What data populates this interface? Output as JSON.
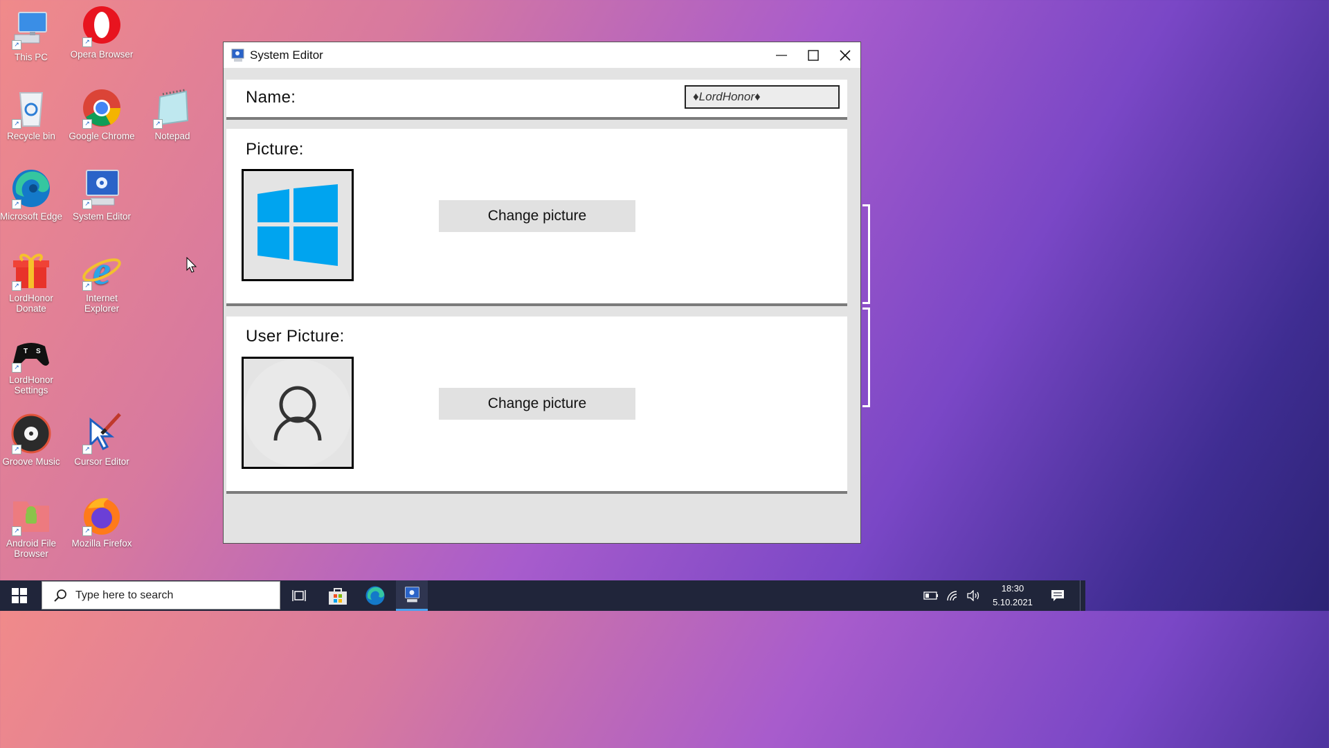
{
  "desktop": {
    "icons": [
      {
        "label": "This PC",
        "icon": "computer-icon"
      },
      {
        "label": "Opera Browser",
        "icon": "opera-icon"
      },
      {
        "label": "Recycle bin",
        "icon": "recycle-bin-icon"
      },
      {
        "label": "Google Chrome",
        "icon": "chrome-icon"
      },
      {
        "label": "Notepad",
        "icon": "notepad-icon"
      },
      {
        "label": "Microsoft Edge",
        "icon": "edge-icon"
      },
      {
        "label": "System Editor",
        "icon": "system-editor-icon"
      },
      {
        "label": "LordHonor Donate",
        "icon": "gift-icon"
      },
      {
        "label": "Internet Explorer",
        "icon": "ie-icon"
      },
      {
        "label": "LordHonor Settings",
        "icon": "gamepad-icon"
      },
      {
        "label": "Groove Music",
        "icon": "groove-icon"
      },
      {
        "label": "Cursor Editor",
        "icon": "cursor-editor-icon"
      },
      {
        "label": "Android File Browser",
        "icon": "android-folder-icon"
      },
      {
        "label": "Mozilla Firefox",
        "icon": "firefox-icon"
      }
    ]
  },
  "window": {
    "title": "System Editor",
    "name_label": "Name:",
    "name_value": "♦LordHonor♦",
    "picture_label": "Picture:",
    "picture_button": "Change picture",
    "user_picture_label": "User Picture:",
    "user_picture_button": "Change picture"
  },
  "taskbar": {
    "search_placeholder": "Type here to search",
    "time": "18:30",
    "date": "5.10.2021"
  },
  "colors": {
    "windows_blue": "#00a4ef",
    "taskbar": "#20253a"
  }
}
